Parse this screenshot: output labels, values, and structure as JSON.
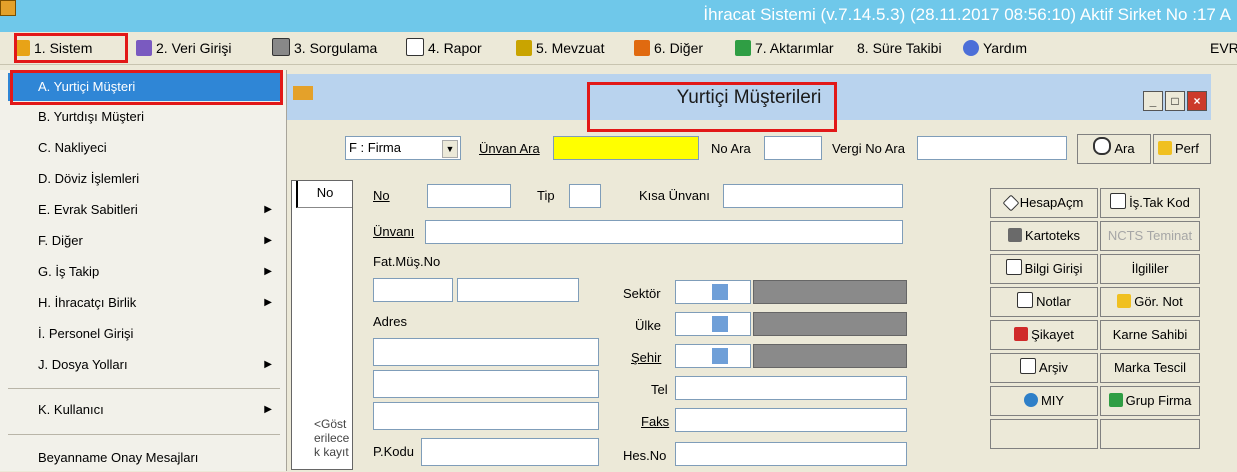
{
  "window": {
    "title": "İhracat Sistemi (v.7.14.5.3) (28.11.2017 08:56:10) Aktif Sirket No :17 A"
  },
  "menubar": {
    "items": [
      {
        "label": "1. Sistem",
        "icon": "folder-icon"
      },
      {
        "label": "2. Veri Girişi",
        "icon": "pencil-icon"
      },
      {
        "label": "3. Sorgulama",
        "icon": "search-doc-icon"
      },
      {
        "label": "4. Rapor",
        "icon": "printer-icon"
      },
      {
        "label": "5. Mevzuat",
        "icon": "books-icon"
      },
      {
        "label": "6. Diğer",
        "icon": "tools-icon"
      },
      {
        "label": "7. Aktarımlar",
        "icon": "transfer-icon"
      },
      {
        "label": "8. Süre Takibi",
        "icon": ""
      },
      {
        "label": "Yardım",
        "icon": "help-icon"
      },
      {
        "label": "EVR",
        "icon": ""
      }
    ]
  },
  "dropdown": {
    "items": [
      {
        "label": "A. Yurtiçi Müşteri",
        "submenu": false,
        "selected": true
      },
      {
        "label": "B. Yurtdışı Müşteri",
        "submenu": false
      },
      {
        "label": "C. Nakliyeci",
        "submenu": false
      },
      {
        "label": "D. Döviz İşlemleri",
        "submenu": false
      },
      {
        "label": "E. Evrak Sabitleri",
        "submenu": true
      },
      {
        "label": "F. Diğer",
        "submenu": true
      },
      {
        "label": "G. İş Takip",
        "submenu": true
      },
      {
        "label": "H. İhracatçı Birlik",
        "submenu": true
      },
      {
        "label": "İ. Personel Girişi",
        "submenu": false
      },
      {
        "label": "J. Dosya Yolları",
        "submenu": true
      },
      {
        "label": "K. Kullanıcı",
        "submenu": true
      },
      {
        "label": "Beyanname Onay Mesajları",
        "submenu": false
      }
    ]
  },
  "form": {
    "title": "Yurtiçi Müşterileri",
    "filter_select": "F : Firma",
    "unvan_ara_label": "Ünvan Ara",
    "no_ara_label": "No Ara",
    "vergi_no_ara_label": "Vergi No Ara",
    "ara_button": "Ara",
    "perf_button": "Perf",
    "grid_header": "No",
    "grid_note": "<Göst erilece k kayıt",
    "no_label": "No",
    "tip_label": "Tip",
    "kisa_unvan_label": "Kısa Ünvanı",
    "unvan_label": "Ünvanı",
    "fat_mus_no_label": "Fat.Müş.No",
    "adres_label": "Adres",
    "pkodu_label": "P.Kodu",
    "sektor_label": "Sektör",
    "ulke_label": "Ülke",
    "sehir_label": "Şehir",
    "tel_label": "Tel",
    "faks_label": "Faks",
    "hes_no_label": "Hes.No"
  },
  "side_buttons": [
    {
      "label": "HesapAçm",
      "icon": "diamond-icon"
    },
    {
      "label": "İş.Tak Kod",
      "icon": "document-icon"
    },
    {
      "label": "Kartoteks",
      "icon": "folder-icon"
    },
    {
      "label": "NCTS Teminat",
      "disabled": true
    },
    {
      "label": "Bilgi Girişi",
      "icon": "pages-icon"
    },
    {
      "label": "İlgililer"
    },
    {
      "label": "Notlar",
      "icon": "notepad-icon"
    },
    {
      "label": "Gör. Not",
      "icon": "glasses-icon"
    },
    {
      "label": "Şikayet",
      "icon": "arrow-doc-icon"
    },
    {
      "label": "Karne Sahibi"
    },
    {
      "label": "Arşiv",
      "icon": "magnifier-doc-icon"
    },
    {
      "label": "Marka Tescil"
    },
    {
      "label": "MIY",
      "icon": "globe-icon"
    },
    {
      "label": "Grup Firma",
      "icon": "tree-icon"
    }
  ],
  "colors": {
    "titlebar": "#6fc8ea",
    "highlight": "#e21818",
    "selected": "#2f86d6",
    "search_field": "#ffff00"
  }
}
